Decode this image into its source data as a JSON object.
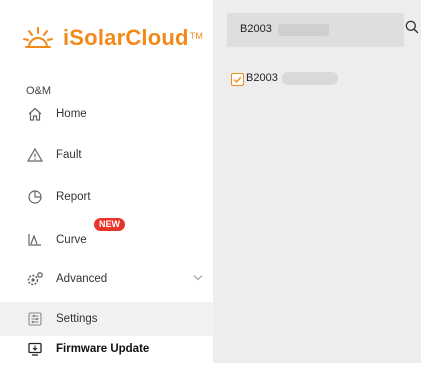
{
  "brand": {
    "name": "iSolarCloud",
    "tm": "TM",
    "color": "#f28a1b"
  },
  "sidebar": {
    "section_label": "O&M",
    "items": [
      {
        "label": "Home",
        "icon": "home-icon"
      },
      {
        "label": "Fault",
        "icon": "warning-icon"
      },
      {
        "label": "Report",
        "icon": "report-icon"
      },
      {
        "label": "Curve",
        "icon": "curve-icon",
        "badge": "NEW"
      },
      {
        "label": "Advanced",
        "icon": "advanced-icon",
        "expandable": true
      },
      {
        "label": "Settings",
        "icon": "settings-icon",
        "active": true
      },
      {
        "label": "Firmware Update",
        "icon": "firmware-update-icon"
      }
    ]
  },
  "main": {
    "search": {
      "value": "B2003"
    },
    "devices": [
      {
        "label": "B2003",
        "checked": true
      }
    ]
  }
}
